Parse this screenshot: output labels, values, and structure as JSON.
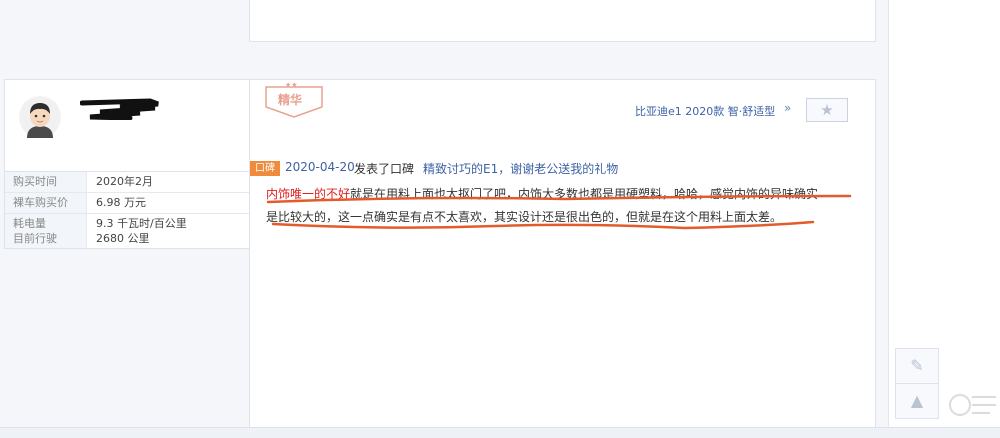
{
  "user": {
    "info": [
      {
        "label": "购买时间",
        "value": "2020年2月"
      },
      {
        "label": "裸车购买价",
        "value": "6.98 万元"
      },
      {
        "label1": "耗电量",
        "label2": "目前行驶",
        "value1": "9.3 千瓦时/百公里",
        "value2": "2680 公里"
      }
    ]
  },
  "review": {
    "badge": "精华",
    "car": "比亚迪e1 2020款 智·舒适型",
    "chevrons": "»",
    "fav_icon": "★",
    "tag": "口碑",
    "date": "2020-04-20",
    "action": "发表了口碑",
    "title": "精致讨巧的E1，谢谢老公送我的礼物",
    "highlight": "内饰唯一的不好",
    "line1_rest": "就是在用料上面也太抠门了吧，内饰大多数也都是用硬塑料，哈哈，感觉内饰的异味确实",
    "line2": "是比较大的，这一点确实是有点不太喜欢，其实设计还是很出色的，但就是在这个用料上面太差。"
  },
  "tools": {
    "edit_icon": "✎",
    "top_icon": "▲"
  },
  "colors": {
    "link": "#3d62a6",
    "tag": "#f08a3c",
    "highlight": "#e0201e",
    "mark": "#e35b2a"
  }
}
